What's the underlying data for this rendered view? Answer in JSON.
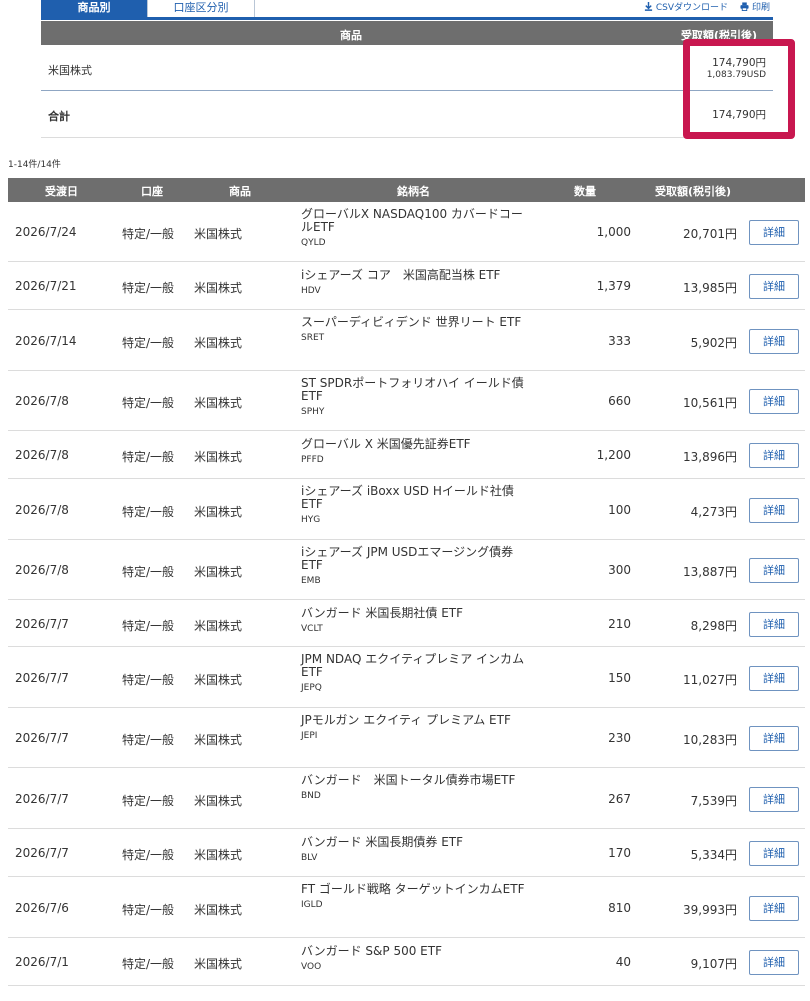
{
  "tabs": [
    {
      "label": "商品別",
      "active": true
    },
    {
      "label": "口座区分別",
      "active": false
    }
  ],
  "links": {
    "csv": "CSVダウンロード",
    "print": "印刷"
  },
  "summary": {
    "headers": {
      "product": "商品",
      "amount": "受取額(税引後)"
    },
    "rows": [
      {
        "label": "米国株式",
        "yen": "174,790円",
        "usd": "1,083.79USD"
      }
    ],
    "total": {
      "label": "合計",
      "yen": "174,790円"
    }
  },
  "count_text": "1-14件/14件",
  "table": {
    "headers": {
      "date": "受渡日",
      "account": "口座",
      "product": "商品",
      "name": "銘柄名",
      "qty": "数量",
      "amount": "受取額(税引後)"
    },
    "detail_label": "詳細",
    "rows": [
      {
        "date": "2026/7/24",
        "account": "特定/一般",
        "product": "米国株式",
        "name": "グローバルX NASDAQ100 カバードコールETF",
        "code": "QYLD",
        "qty": "1,000",
        "amount": "20,701円"
      },
      {
        "date": "2026/7/21",
        "account": "特定/一般",
        "product": "米国株式",
        "name": "iシェアーズ コア　米国高配当株 ETF",
        "code": "HDV",
        "qty": "1,379",
        "amount": "13,985円"
      },
      {
        "date": "2026/7/14",
        "account": "特定/一般",
        "product": "米国株式",
        "name": "スーパーディビィデンド 世界リート ETF",
        "code": "SRET",
        "qty": "333",
        "amount": "5,902円"
      },
      {
        "date": "2026/7/8",
        "account": "特定/一般",
        "product": "米国株式",
        "name": "ST SPDRポートフォリオハイ イールド債 ETF",
        "code": "SPHY",
        "qty": "660",
        "amount": "10,561円"
      },
      {
        "date": "2026/7/8",
        "account": "特定/一般",
        "product": "米国株式",
        "name": "グローバル X 米国優先証券ETF",
        "code": "PFFD",
        "qty": "1,200",
        "amount": "13,896円"
      },
      {
        "date": "2026/7/8",
        "account": "特定/一般",
        "product": "米国株式",
        "name": "iシェアーズ iBoxx USD Hイールド社債 ETF",
        "code": "HYG",
        "qty": "100",
        "amount": "4,273円"
      },
      {
        "date": "2026/7/8",
        "account": "特定/一般",
        "product": "米国株式",
        "name": "iシェアーズ JPM USDエマージング債券 ETF",
        "code": "EMB",
        "qty": "300",
        "amount": "13,887円"
      },
      {
        "date": "2026/7/7",
        "account": "特定/一般",
        "product": "米国株式",
        "name": "バンガード 米国長期社債 ETF",
        "code": "VCLT",
        "qty": "210",
        "amount": "8,298円"
      },
      {
        "date": "2026/7/7",
        "account": "特定/一般",
        "product": "米国株式",
        "name": "JPM NDAQ エクイティプレミア インカム ETF",
        "code": "JEPQ",
        "qty": "150",
        "amount": "11,027円"
      },
      {
        "date": "2026/7/7",
        "account": "特定/一般",
        "product": "米国株式",
        "name": "JPモルガン エクイティ プレミアム ETF",
        "code": "JEPI",
        "qty": "230",
        "amount": "10,283円"
      },
      {
        "date": "2026/7/7",
        "account": "特定/一般",
        "product": "米国株式",
        "name": "バンガード　米国トータル債券市場ETF",
        "code": "BND",
        "qty": "267",
        "amount": "7,539円"
      },
      {
        "date": "2026/7/7",
        "account": "特定/一般",
        "product": "米国株式",
        "name": "バンガード 米国長期債券 ETF",
        "code": "BLV",
        "qty": "170",
        "amount": "5,334円"
      },
      {
        "date": "2026/7/6",
        "account": "特定/一般",
        "product": "米国株式",
        "name": "FT ゴールド戦略 ターゲットインカムETF",
        "code": "IGLD",
        "qty": "810",
        "amount": "39,993円"
      },
      {
        "date": "2026/7/1",
        "account": "特定/一般",
        "product": "米国株式",
        "name": "バンガード S&P 500 ETF",
        "code": "VOO",
        "qty": "40",
        "amount": "9,107円"
      }
    ]
  }
}
